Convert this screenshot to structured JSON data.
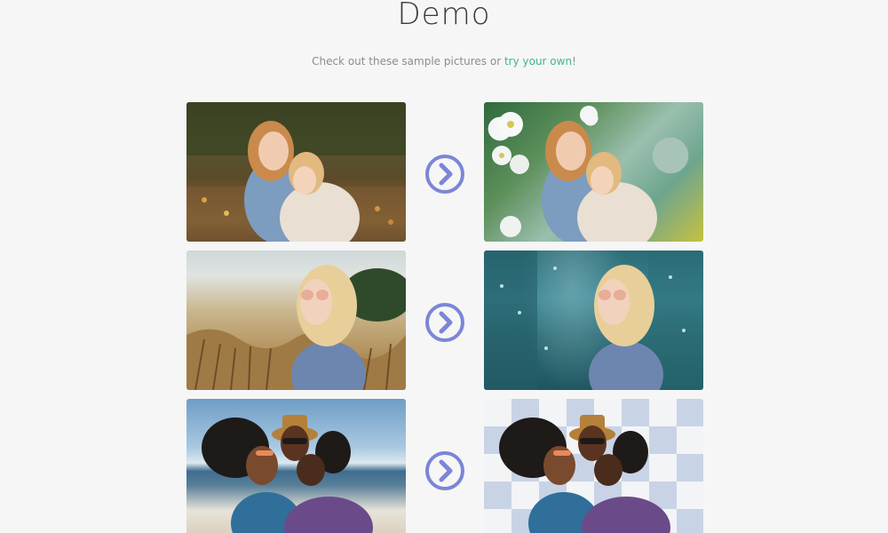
{
  "header": {
    "title": "Demo",
    "subtitle_prefix": "Check out these sample pictures or ",
    "subtitle_link": "try your own",
    "subtitle_suffix": "!"
  },
  "colors": {
    "background": "#f6f6f6",
    "accent_link": "#3fb58f",
    "arrow": "#7b86d6",
    "title": "#3a3a3a",
    "subtitle": "#8c8c8c"
  },
  "samples": [
    {
      "original": "two girls hugging in autumn leaves",
      "result": "two girls hugging with white flowers background",
      "arrow_icon": "chevron-right-circle-icon"
    },
    {
      "original": "blonde woman in sunglasses in wheat field",
      "result": "blonde woman in sunglasses with rainy teal city background",
      "arrow_icon": "chevron-right-circle-icon"
    },
    {
      "original": "three friends posing on a beach",
      "result": "three friends with transparent checkered background",
      "arrow_icon": "chevron-right-circle-icon"
    }
  ]
}
